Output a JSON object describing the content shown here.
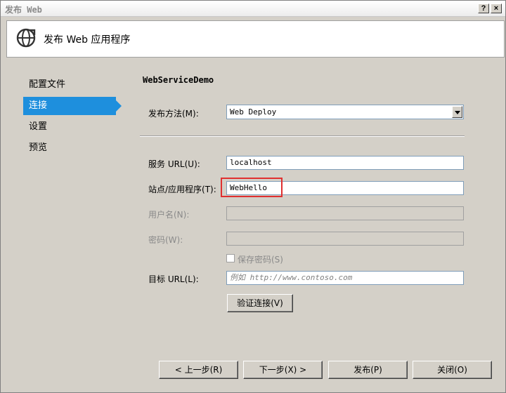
{
  "window": {
    "title": "发布 Web",
    "help_label": "?",
    "close_label": "×"
  },
  "header": {
    "title": "发布 Web 应用程序"
  },
  "nav": {
    "items": [
      {
        "label": "配置文件"
      },
      {
        "label": "连接"
      },
      {
        "label": "设置"
      },
      {
        "label": "预览"
      }
    ],
    "active_index": 1
  },
  "form": {
    "profile_name": "WebServiceDemo",
    "publish_method": {
      "label": "发布方法(M):",
      "value": "Web Deploy"
    },
    "service_url": {
      "label": "服务 URL(U):",
      "value": "localhost"
    },
    "site_app": {
      "label": "站点/应用程序(T):",
      "value": "WebHello"
    },
    "username": {
      "label": "用户名(N):",
      "value": ""
    },
    "password": {
      "label": "密码(W):",
      "value": ""
    },
    "save_password": {
      "label": "保存密码(S)",
      "checked": false
    },
    "target_url": {
      "label": "目标 URL(L):",
      "value": "",
      "placeholder": "例如 http://www.contoso.com"
    },
    "validate_button": "验证连接(V)"
  },
  "footer": {
    "prev_button": "< 上一步(R)",
    "next_button": "下一步(X) >",
    "publish_button": "发布(P)",
    "close_button": "关闭(O)"
  },
  "colors": {
    "accent": "#1e8fdd",
    "highlight": "#e03030"
  }
}
